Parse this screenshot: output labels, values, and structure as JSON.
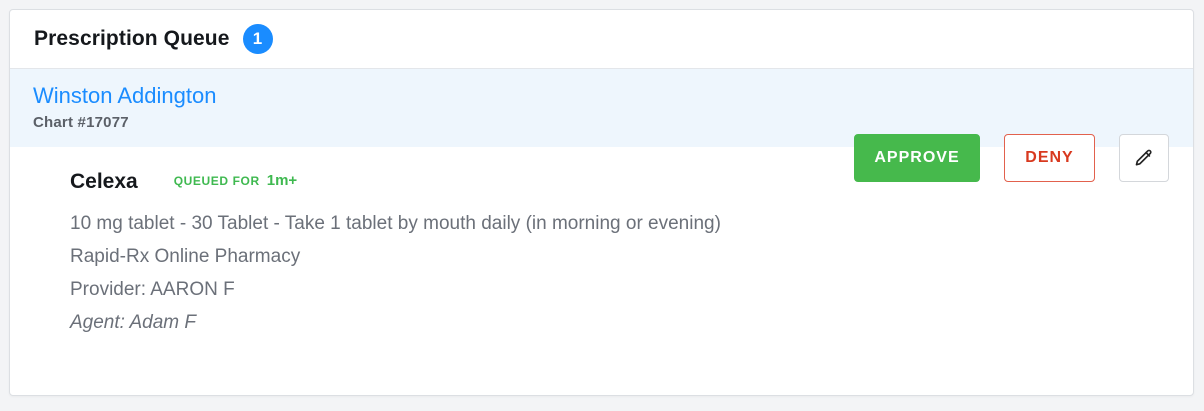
{
  "queue": {
    "title": "Prescription Queue",
    "count": "1"
  },
  "patient": {
    "name": "Winston Addington",
    "chart": "Chart #17077"
  },
  "prescription": {
    "drug": "Celexa",
    "queued_label": "QUEUED FOR",
    "queued_time": "1m+",
    "sig": "10 mg tablet - 30 Tablet - Take 1 tablet by mouth daily (in morning or evening)",
    "pharmacy": "Rapid-Rx Online Pharmacy",
    "provider": "Provider: AARON F",
    "agent": "Agent: Adam F"
  },
  "actions": {
    "approve_label": "APPROVE",
    "deny_label": "DENY",
    "edit_icon": "pencil-icon"
  },
  "colors": {
    "accent": "#1a8cff",
    "approve": "#46b94c",
    "deny": "#d8391f",
    "queued": "#3fb950",
    "patient_bg": "#eef6fd"
  }
}
